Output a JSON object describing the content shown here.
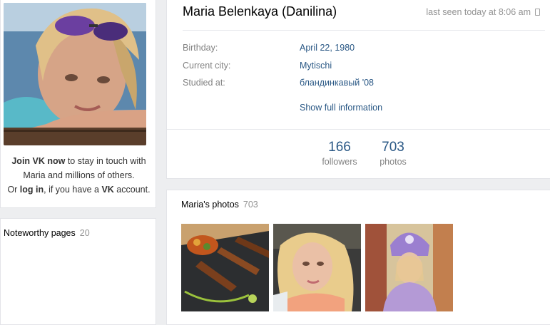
{
  "profile": {
    "name": "Maria Belenkaya (Danilina)",
    "last_seen": "last seen today at 8:06 am",
    "info": [
      {
        "label": "Birthday:",
        "value": "April 22, 1980"
      },
      {
        "label": "Current city:",
        "value": "Mytischi"
      },
      {
        "label": "Studied at:",
        "value": "бландинкавый '08"
      }
    ],
    "show_full": "Show full information",
    "counters": [
      {
        "number": "166",
        "label": "followers"
      },
      {
        "number": "703",
        "label": "photos"
      }
    ]
  },
  "join": {
    "line1_bold": "Join VK now",
    "line1_rest": " to stay in touch with",
    "line2": "Maria and millions of others.",
    "line3_pre": "Or ",
    "line3_link": "log in",
    "line3_mid": ", if you have a ",
    "line3_bold": "VK",
    "line3_post": " account."
  },
  "noteworthy": {
    "title": "Noteworthy pages",
    "count": "20"
  },
  "photos": {
    "title": "Maria's photos",
    "count": "703"
  },
  "colors": {
    "link": "#2a5885",
    "muted": "#828282",
    "background": "#edeef0"
  }
}
